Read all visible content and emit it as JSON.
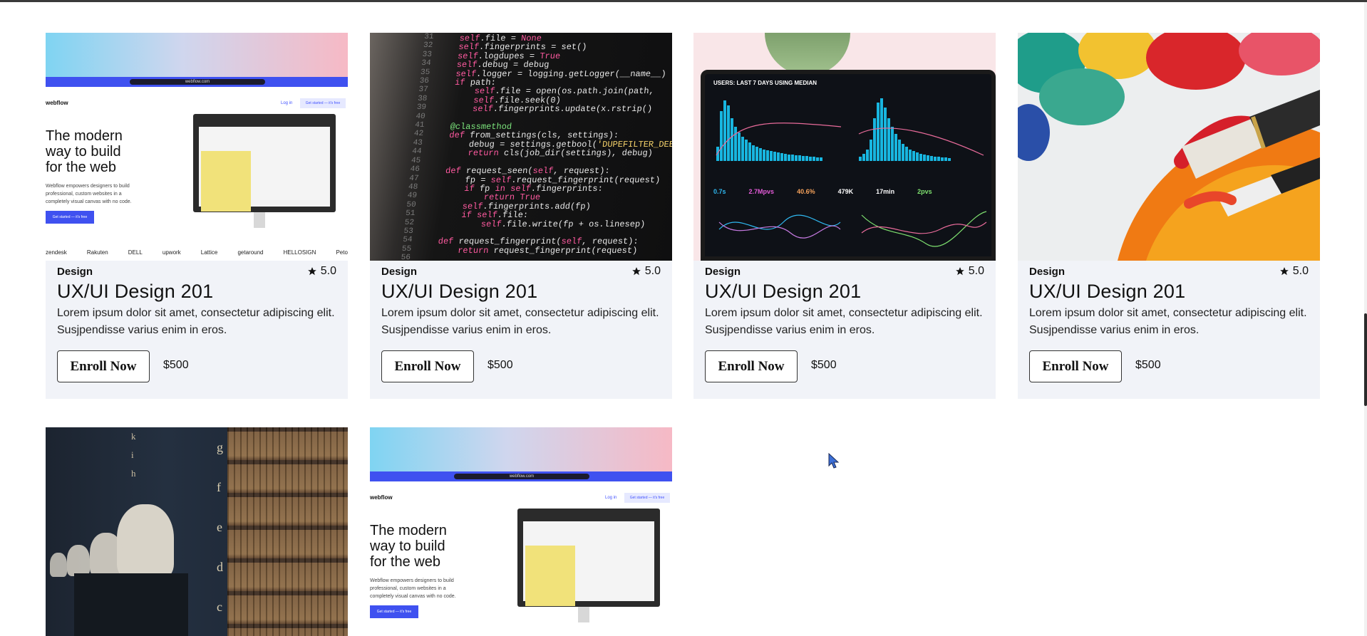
{
  "courses": [
    {
      "category": "Design",
      "rating": "5.0",
      "title": "UX/UI Design 201",
      "description": "Lorem ipsum dolor sit amet, consectetur adipiscing elit. Susjpendisse varius enim in eros.",
      "enroll_label": "Enroll Now",
      "price": "$500",
      "image": "webflow-site"
    },
    {
      "category": "Design",
      "rating": "5.0",
      "title": "UX/UI Design 201",
      "description": "Lorem ipsum dolor sit amet, consectetur adipiscing elit. Susjpendisse varius enim in eros.",
      "enroll_label": "Enroll Now",
      "price": "$500",
      "image": "python-code"
    },
    {
      "category": "Design",
      "rating": "5.0",
      "title": "UX/UI Design 201",
      "description": "Lorem ipsum dolor sit amet, consectetur adipiscing elit. Susjpendisse varius enim in eros.",
      "enroll_label": "Enroll Now",
      "price": "$500",
      "image": "analytics-dashboard"
    },
    {
      "category": "Design",
      "rating": "5.0",
      "title": "UX/UI Design 201",
      "description": "Lorem ipsum dolor sit amet, consectetur adipiscing elit. Susjpendisse varius enim in eros.",
      "enroll_label": "Enroll Now",
      "price": "$500",
      "image": "paint-brushes"
    },
    {
      "image": "library-busts"
    },
    {
      "image": "webflow-site"
    }
  ],
  "webflow_mock": {
    "url": "webflow.com",
    "logo": "webflow",
    "login": "Log in",
    "get_started": "Get started — it's free",
    "hero": "The modern way to build for the web",
    "sub": "Webflow empowers designers to build professional, custom websites in a completely visual canvas with no code.",
    "cta": "Get started — it's free",
    "logos": [
      "zendesk",
      "Rakuten",
      "DELL",
      "upwork",
      "Lattice",
      "getaround",
      "HELLOSIGN",
      "Peto"
    ]
  },
  "code_mock": {
    "line_numbers": [
      "31",
      "32",
      "33",
      "34",
      "35",
      "36",
      "37",
      "38",
      "39",
      "40",
      "41",
      "42",
      "43",
      "44",
      "45",
      "46",
      "47",
      "48",
      "49",
      "50",
      "51",
      "52",
      "53",
      "54",
      "55",
      "56"
    ],
    "lines": [
      "self.file = None",
      "self.fingerprints = set()",
      "self.logdupes = True",
      "self.debug = debug",
      "self.logger = logging.getLogger(__name__)",
      "if path:",
      "    self.file = open(os.path.join(path,",
      "    self.file.seek(0)",
      "    self.fingerprints.update(x.rstrip()",
      "",
      "@classmethod",
      "def from_settings(cls, settings):",
      "    debug = settings.getbool('DUPEFILTER_DEBUG')",
      "    return cls(job_dir(settings), debug)",
      "",
      "def request_seen(self, request):",
      "    fp = self.request_fingerprint(request)",
      "    if fp in self.fingerprints:",
      "        return True",
      "    self.fingerprints.add(fp)",
      "    if self.file:",
      "        self.file.write(fp + os.linesep)",
      "",
      "def request_fingerprint(self, request):",
      "    return request_fingerprint(request)"
    ]
  },
  "dashboard_mock": {
    "title": "USERS: LAST 7 DAYS USING MEDIAN",
    "kpis": [
      "0.7s",
      "2.7Mpvs",
      "40.6%",
      "479K",
      "17min",
      "2pvs"
    ]
  },
  "colors": {
    "card_bg": "#f1f3f8",
    "text": "#111111",
    "webflow_blue": "#3f51f0"
  }
}
